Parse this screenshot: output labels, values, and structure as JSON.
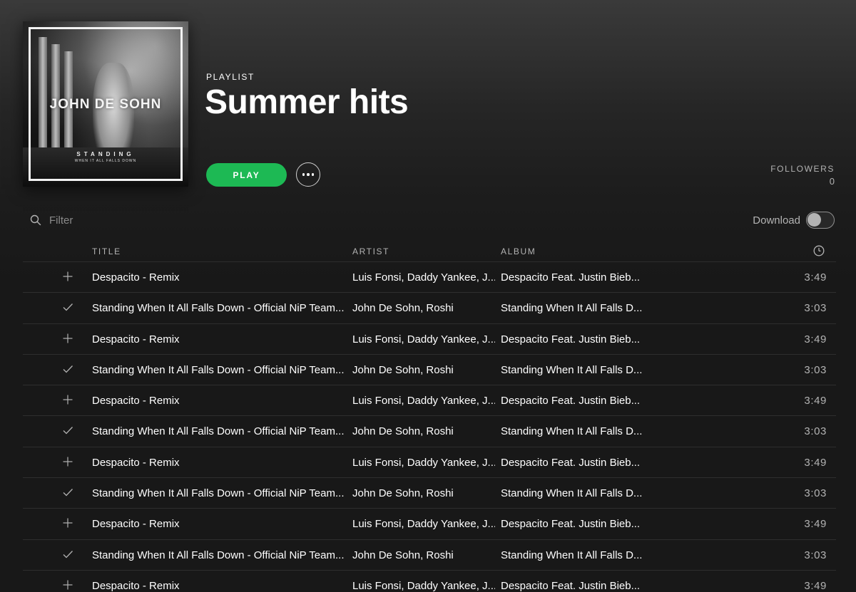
{
  "header": {
    "type_label": "PLAYLIST",
    "title": "Summer hits",
    "play_label": "PLAY",
    "followers_label": "FOLLOWERS",
    "followers_count": "0",
    "cover": {
      "artist_text": "JOHN DE SOHN",
      "album_line1": "STANDING",
      "album_line2": "WHEN IT ALL FALLS DOWN"
    }
  },
  "filter": {
    "placeholder": "Filter",
    "value": ""
  },
  "download": {
    "label": "Download",
    "enabled": false
  },
  "table": {
    "headers": {
      "title": "TITLE",
      "artist": "ARTIST",
      "album": "ALBUM",
      "duration_icon": "clock-icon"
    },
    "rows": [
      {
        "icon": "plus-icon",
        "title": "Despacito - Remix",
        "artist": "Luis Fonsi, Daddy Yankee, J...",
        "album": "Despacito Feat. Justin Bieb...",
        "duration": "3:49"
      },
      {
        "icon": "check-icon",
        "title": "Standing When It All Falls Down - Official NiP Team...",
        "artist": "John De Sohn, Roshi",
        "album": "Standing When It All Falls D...",
        "duration": "3:03"
      },
      {
        "icon": "plus-icon",
        "title": "Despacito - Remix",
        "artist": "Luis Fonsi, Daddy Yankee, J...",
        "album": "Despacito Feat. Justin Bieb...",
        "duration": "3:49"
      },
      {
        "icon": "check-icon",
        "title": "Standing When It All Falls Down - Official NiP Team...",
        "artist": "John De Sohn, Roshi",
        "album": "Standing When It All Falls D...",
        "duration": "3:03"
      },
      {
        "icon": "plus-icon",
        "title": "Despacito - Remix",
        "artist": "Luis Fonsi, Daddy Yankee, J...",
        "album": "Despacito Feat. Justin Bieb...",
        "duration": "3:49"
      },
      {
        "icon": "check-icon",
        "title": "Standing When It All Falls Down - Official NiP Team...",
        "artist": "John De Sohn, Roshi",
        "album": "Standing When It All Falls D...",
        "duration": "3:03"
      },
      {
        "icon": "plus-icon",
        "title": "Despacito - Remix",
        "artist": "Luis Fonsi, Daddy Yankee, J...",
        "album": "Despacito Feat. Justin Bieb...",
        "duration": "3:49"
      },
      {
        "icon": "check-icon",
        "title": "Standing When It All Falls Down - Official NiP Team...",
        "artist": "John De Sohn, Roshi",
        "album": "Standing When It All Falls D...",
        "duration": "3:03"
      },
      {
        "icon": "plus-icon",
        "title": "Despacito - Remix",
        "artist": "Luis Fonsi, Daddy Yankee, J...",
        "album": "Despacito Feat. Justin Bieb...",
        "duration": "3:49"
      },
      {
        "icon": "check-icon",
        "title": "Standing When It All Falls Down - Official NiP Team...",
        "artist": "John De Sohn, Roshi",
        "album": "Standing When It All Falls D...",
        "duration": "3:03"
      },
      {
        "icon": "plus-icon",
        "title": "Despacito - Remix",
        "artist": "Luis Fonsi, Daddy Yankee, J...",
        "album": "Despacito Feat. Justin Bieb...",
        "duration": "3:49"
      }
    ]
  },
  "colors": {
    "accent": "#1db954",
    "background": "#181818",
    "muted_text": "#b3b3b3"
  }
}
